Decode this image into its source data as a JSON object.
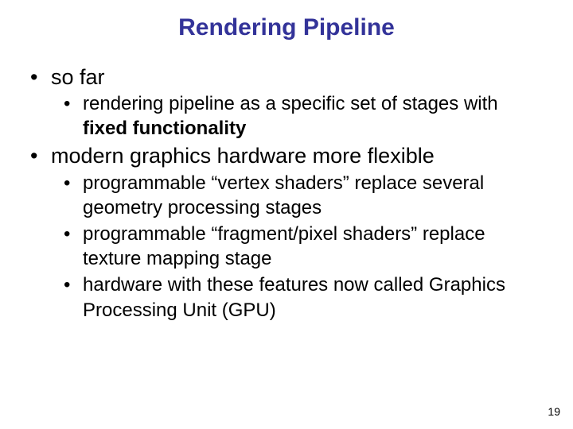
{
  "title": "Rendering Pipeline",
  "bullets": {
    "soFar": "so far",
    "soFarSub1a": "rendering pipeline as a specific set of stages with ",
    "soFarSub1b": "fixed functionality",
    "modern": "modern graphics hardware more flexible",
    "modernSub1": "programmable “vertex shaders” replace several  geometry processing stages",
    "modernSub2": "programmable “fragment/pixel shaders” replace texture mapping stage",
    "modernSub3": "hardware with these features now called Graphics Processing Unit (GPU)"
  },
  "pageNumber": "19"
}
